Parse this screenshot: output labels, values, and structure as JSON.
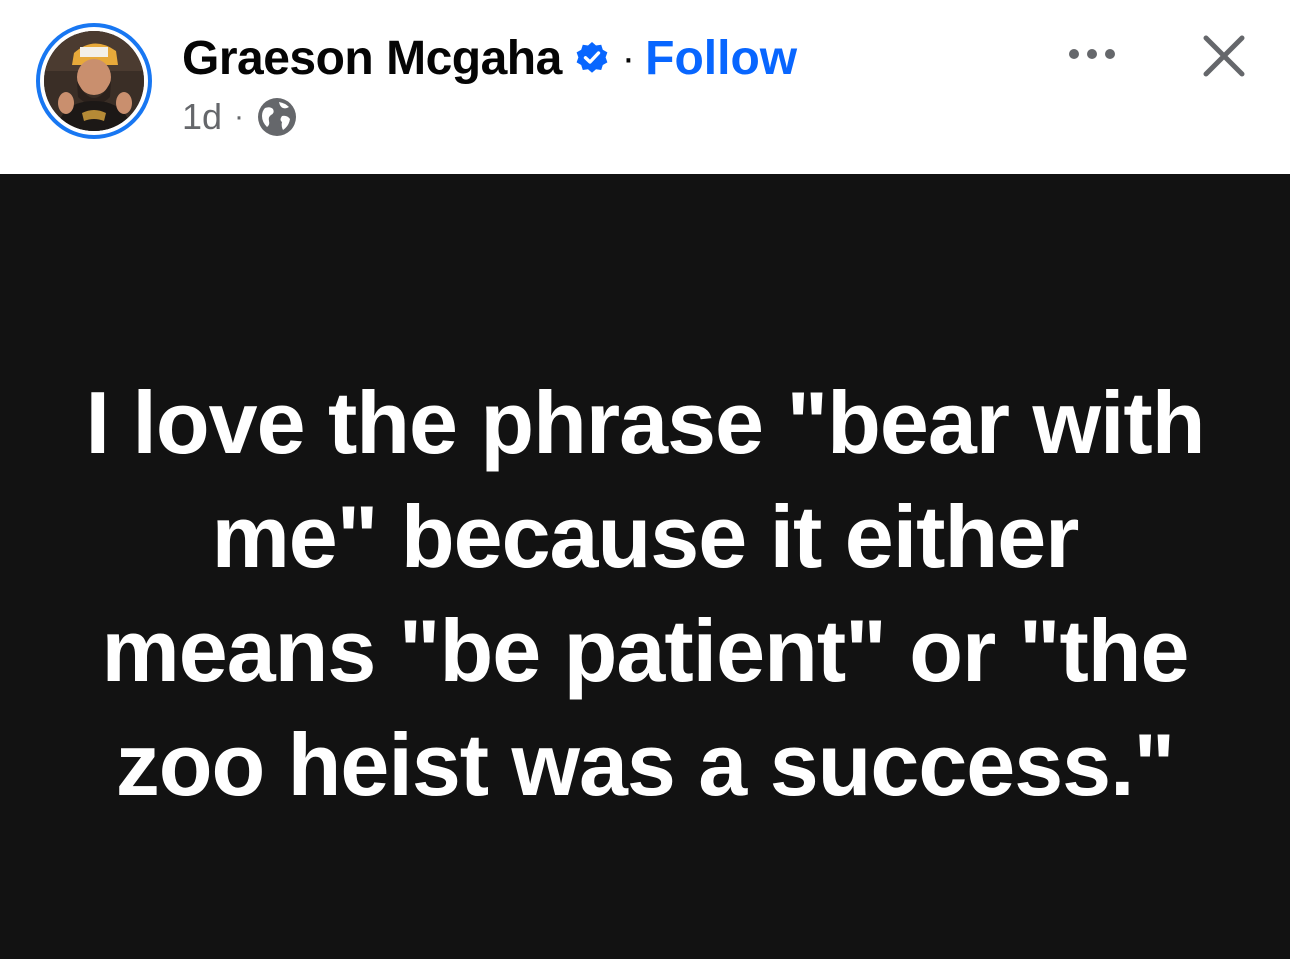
{
  "author": {
    "name": "Graeson Mcgaha",
    "verified_icon": "verified-badge-icon",
    "separator": "·",
    "follow_label": "Follow"
  },
  "meta": {
    "timestamp": "1d",
    "separator": "·",
    "audience_icon": "globe-icon"
  },
  "actions": {
    "more_icon": "more-options-icon",
    "close_icon": "close-icon"
  },
  "post": {
    "text": "I love the phrase \"bear with me\" because it either means \"be patient\" or \"the zoo heist was a success.\"",
    "background": "#121212",
    "text_color": "#ffffff"
  },
  "colors": {
    "accent": "#0866ff",
    "avatar_ring": "#1877f2",
    "secondary_text": "#65676b"
  }
}
